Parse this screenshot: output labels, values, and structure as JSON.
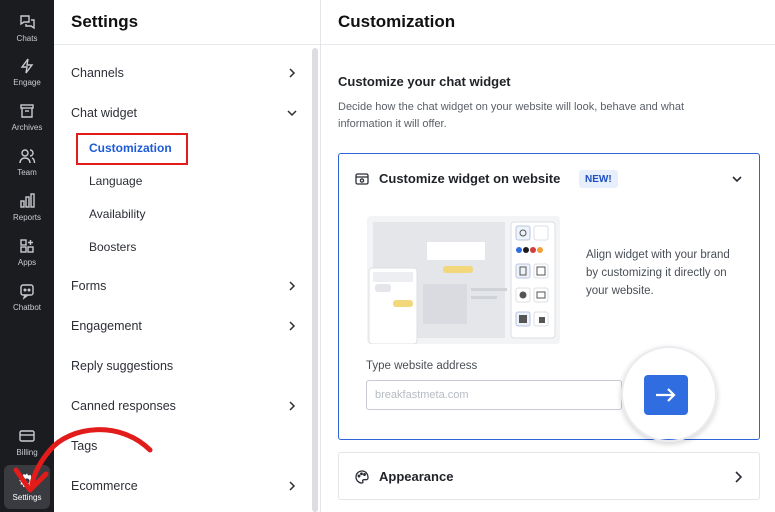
{
  "rail": {
    "items": [
      {
        "label": "Chats",
        "icon": "chat-bubbles-icon"
      },
      {
        "label": "Engage",
        "icon": "lightning-icon"
      },
      {
        "label": "Archives",
        "icon": "archive-box-icon"
      },
      {
        "label": "Team",
        "icon": "team-icon"
      },
      {
        "label": "Reports",
        "icon": "bar-chart-icon"
      },
      {
        "label": "Apps",
        "icon": "apps-grid-icon"
      },
      {
        "label": "Chatbot",
        "icon": "chatbot-icon"
      }
    ],
    "bottom": [
      {
        "label": "Billing",
        "icon": "credit-card-icon"
      },
      {
        "label": "Settings",
        "icon": "gear-icon"
      }
    ]
  },
  "settings": {
    "title": "Settings",
    "menu": [
      {
        "label": "Channels"
      },
      {
        "label": "Chat widget"
      },
      {
        "label": "Forms"
      },
      {
        "label": "Engagement"
      },
      {
        "label": "Reply suggestions"
      },
      {
        "label": "Canned responses"
      },
      {
        "label": "Tags"
      },
      {
        "label": "Ecommerce"
      }
    ],
    "chat_widget_sub": [
      {
        "label": "Customization"
      },
      {
        "label": "Language"
      },
      {
        "label": "Availability"
      },
      {
        "label": "Boosters"
      }
    ]
  },
  "main": {
    "title": "Customization",
    "section_title": "Customize your chat widget",
    "section_desc": "Decide how the chat widget on your website will look, behave and what information it will offer.",
    "card": {
      "title": "Customize widget on website",
      "badge": "NEW!",
      "align_text": "Align widget with your brand by customizing it directly on your website.",
      "address_label": "Type website address",
      "address_placeholder": "breakfastmeta.com"
    },
    "appearance": {
      "title": "Appearance"
    }
  },
  "colors": {
    "accent": "#2f6de1",
    "annotation": "#e21b1b",
    "rail_bg": "#1b1c20"
  }
}
